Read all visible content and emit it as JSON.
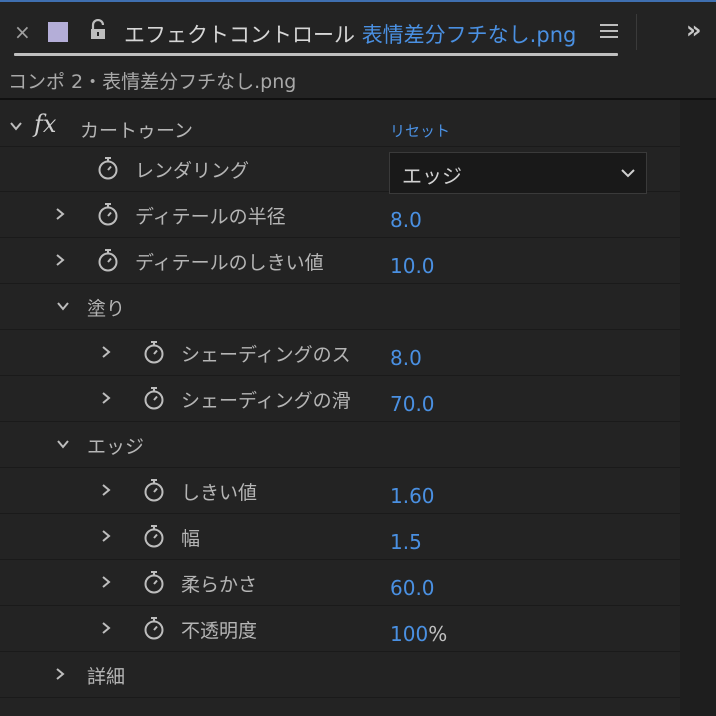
{
  "tab": {
    "close_glyph": "×",
    "title": "エフェクトコントロール",
    "subtitle": "表情差分フチなし.png",
    "swatch_color": "#b4aed8",
    "more_glyph": "»"
  },
  "header": {
    "path": "コンポ 2・表情差分フチなし.png"
  },
  "effect": {
    "fx_label": "fx",
    "name": "カートゥーン",
    "reset_label": "リセット",
    "rendering": {
      "label": "レンダリング",
      "value": "エッジ"
    },
    "detail_radius": {
      "label": "ディテールの半径",
      "value": "8.0"
    },
    "detail_threshold": {
      "label": "ディテールのしきい値",
      "value": "10.0"
    },
    "fill": {
      "label": "塗り",
      "shading_steps": {
        "label": "シェーディングのス",
        "value": "8.0"
      },
      "shading_smoothness": {
        "label": "シェーディングの滑",
        "value": "70.0"
      }
    },
    "edge": {
      "label": "エッジ",
      "threshold": {
        "label": "しきい値",
        "value": "1.60"
      },
      "width": {
        "label": "幅",
        "value": "1.5"
      },
      "softness": {
        "label": "柔らかさ",
        "value": "60.0"
      },
      "opacity": {
        "label": "不透明度",
        "value": "100",
        "unit": "%"
      }
    },
    "advanced": {
      "label": "詳細"
    }
  },
  "colors": {
    "accent": "#4a90e2",
    "panel_bg": "#232323",
    "text": "#b5b5b5"
  }
}
